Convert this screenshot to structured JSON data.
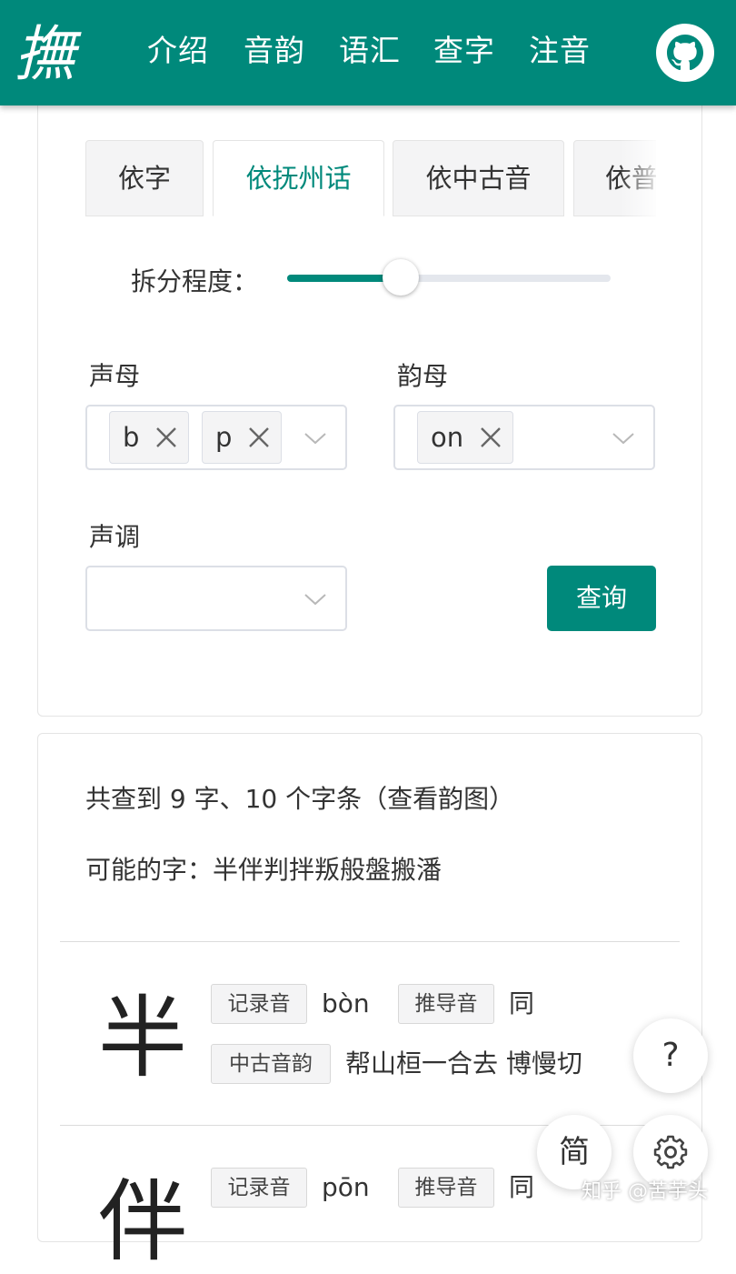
{
  "header": {
    "logo_text": "撫",
    "nav": [
      "介绍",
      "音韵",
      "语汇",
      "查字",
      "注音"
    ],
    "github_icon": "github-icon"
  },
  "query": {
    "tabs": [
      "依字",
      "依抚州话",
      "依中古音",
      "依普"
    ],
    "active_tab": 1,
    "split_label": "拆分程度：",
    "split_level_fraction": 0.35,
    "initials_label": "声母",
    "initials_tags": [
      "b",
      "p"
    ],
    "finals_label": "韵母",
    "finals_tags": [
      "on"
    ],
    "tone_label": "声调",
    "tone_value": "",
    "submit_label": "查询"
  },
  "results": {
    "summary_prefix": "共查到 9 字、10 个字条",
    "summary_link": "（查看韵图）",
    "possible_label": "可能的字：",
    "possible_chars": "半伴判拌叛般盤搬潘",
    "entries": [
      {
        "char": "半",
        "recorded_tag": "记录音",
        "recorded": "bòn",
        "derived_tag": "推导音",
        "derived": "同",
        "mc_tag": "中古音韵",
        "mc": "帮山桓一合去 博慢切"
      },
      {
        "char": "伴",
        "recorded_tag": "记录音",
        "recorded": "pōn",
        "derived_tag": "推导音",
        "derived": "同"
      }
    ]
  },
  "fabs": {
    "help": "?",
    "script": "简",
    "settings_icon": "gear-icon"
  },
  "watermark": "知乎 @苦芋头",
  "colors": {
    "primary": "#00897b",
    "track": "#e4e7ed",
    "tag_bg": "#f4f4f5"
  }
}
